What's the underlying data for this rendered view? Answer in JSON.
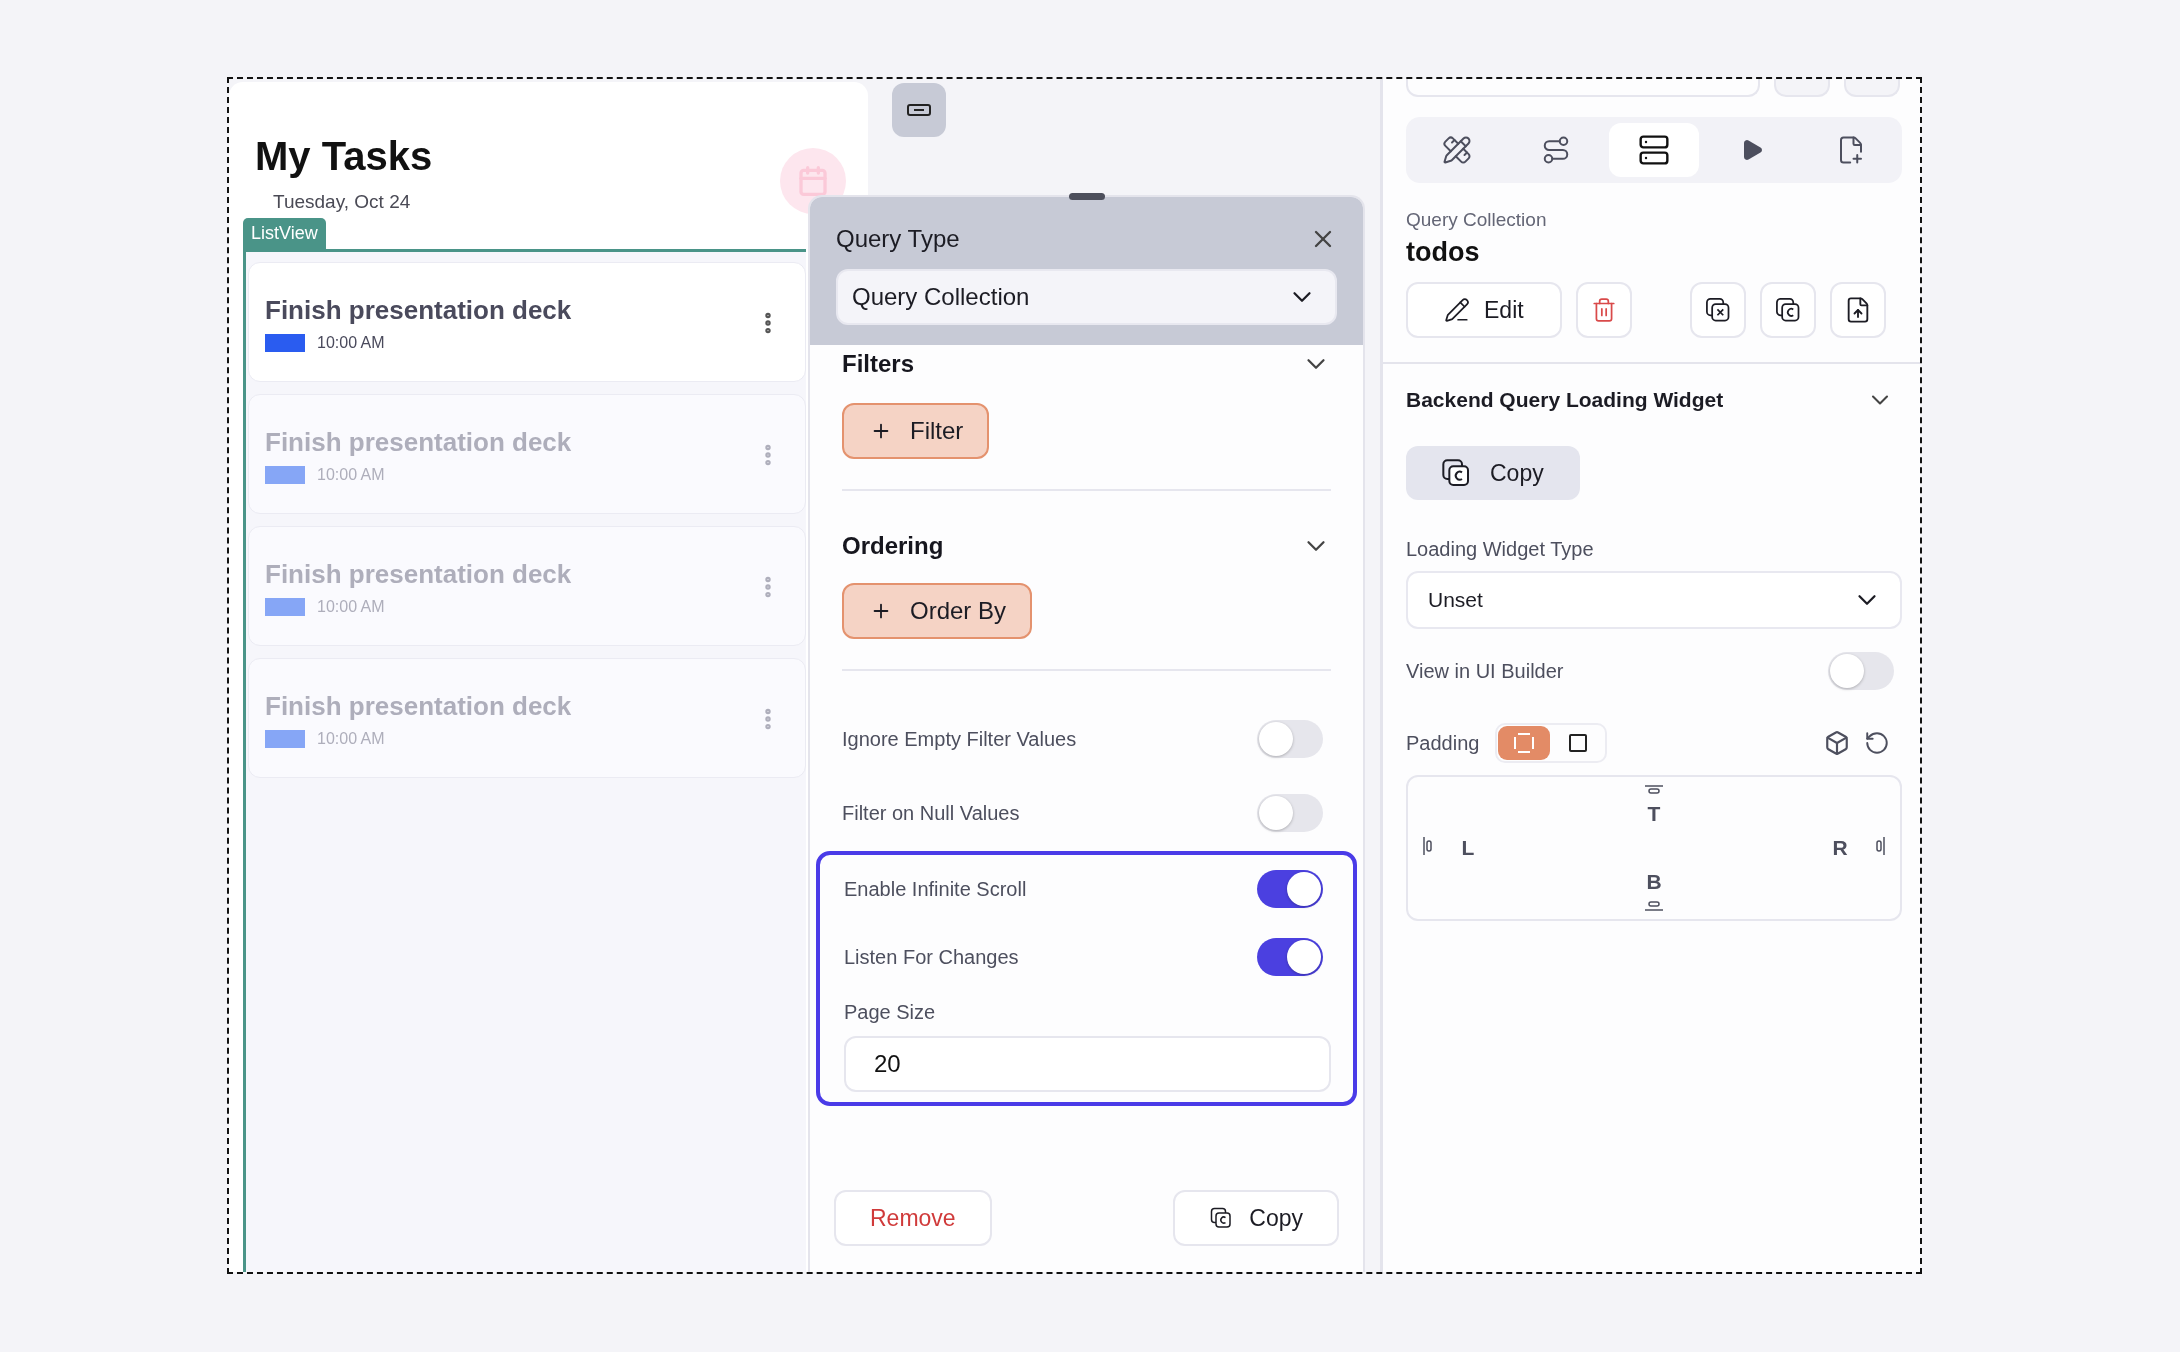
{
  "phone": {
    "title": "My Tasks",
    "date": "Tuesday, Oct 24",
    "list_tag": "ListView",
    "tasks": [
      {
        "title": "Finish presentation deck",
        "time": "10:00 AM",
        "dimmed": false
      },
      {
        "title": "Finish presentation deck",
        "time": "10:00 AM",
        "dimmed": true
      },
      {
        "title": "Finish presentation deck",
        "time": "10:00 AM",
        "dimmed": true
      },
      {
        "title": "Finish presentation deck",
        "time": "10:00 AM",
        "dimmed": true
      }
    ]
  },
  "query_panel": {
    "header_label": "Query Type",
    "query_type": "Query Collection",
    "sections": [
      {
        "title": "Filters",
        "button": "Filter"
      },
      {
        "title": "Ordering",
        "button": "Order By"
      }
    ],
    "toggles": [
      {
        "label": "Ignore Empty Filter Values",
        "on": false
      },
      {
        "label": "Filter on Null Values",
        "on": false
      }
    ],
    "focus_group": {
      "toggles": [
        {
          "label": "Enable Infinite Scroll",
          "on": true
        },
        {
          "label": "Listen For Changes",
          "on": true
        }
      ],
      "page_size_label": "Page Size",
      "page_size": "20"
    },
    "remove_button": "Remove",
    "copy_button": "Copy"
  },
  "inspector": {
    "tabs": [
      {
        "kind": "design",
        "selected": false
      },
      {
        "kind": "actions",
        "selected": false
      },
      {
        "kind": "backend",
        "selected": true
      },
      {
        "kind": "run",
        "selected": false
      },
      {
        "kind": "notes",
        "selected": false
      }
    ],
    "query_kind": "Query Collection",
    "query_name": "todos",
    "edit_button": "Edit",
    "section_title": "Backend Query Loading Widget",
    "copy_button": "Copy",
    "loading_widget_type_label": "Loading Widget Type",
    "loading_widget_type": "Unset",
    "view_in_builder": {
      "label": "View in UI Builder",
      "on": false
    },
    "padding": {
      "label": "Padding",
      "modes": [
        {
          "kind": "linked",
          "selected": true
        },
        {
          "kind": "single",
          "selected": false
        }
      ],
      "top": "T",
      "left": "L",
      "right": "R",
      "bottom": "B"
    }
  }
}
